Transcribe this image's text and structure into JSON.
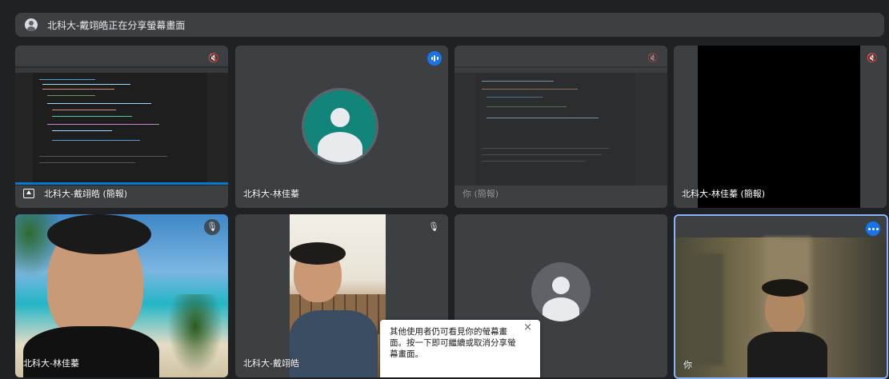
{
  "banner": {
    "text": "北科大-戴翊皓正在分享螢幕畫面",
    "icon": "person-icon"
  },
  "tiles": {
    "t1": {
      "label": "北科大-戴翊皓 (簡報)",
      "state": "muted",
      "icon": "present-to-all-icon"
    },
    "t2": {
      "label": "北科大-林佳蓁",
      "state": "speaking",
      "avatar_color": "#12857a"
    },
    "t3": {
      "label": "你 (簡報)",
      "state": "muted"
    },
    "t4": {
      "label": "北科大-林佳蓁 (簡報)",
      "state": "muted"
    },
    "t5": {
      "label": "北科大-林佳蓁",
      "state": "mic-muted"
    },
    "t6": {
      "label": "北科大-戴翊皓",
      "state": "mic-muted"
    },
    "t7": {
      "label": "",
      "avatar_color": "#5f6368"
    },
    "t8": {
      "label": "你",
      "state": "more-options",
      "highlight": "#8ab4f8"
    }
  },
  "toast": {
    "message": "其他使用者仍可看見你的螢幕畫面。按一下即可繼續或取消分享螢幕畫面。",
    "close": "×"
  },
  "colors": {
    "background": "#202124",
    "tile": "#3c4043",
    "accent": "#1a73e8"
  }
}
